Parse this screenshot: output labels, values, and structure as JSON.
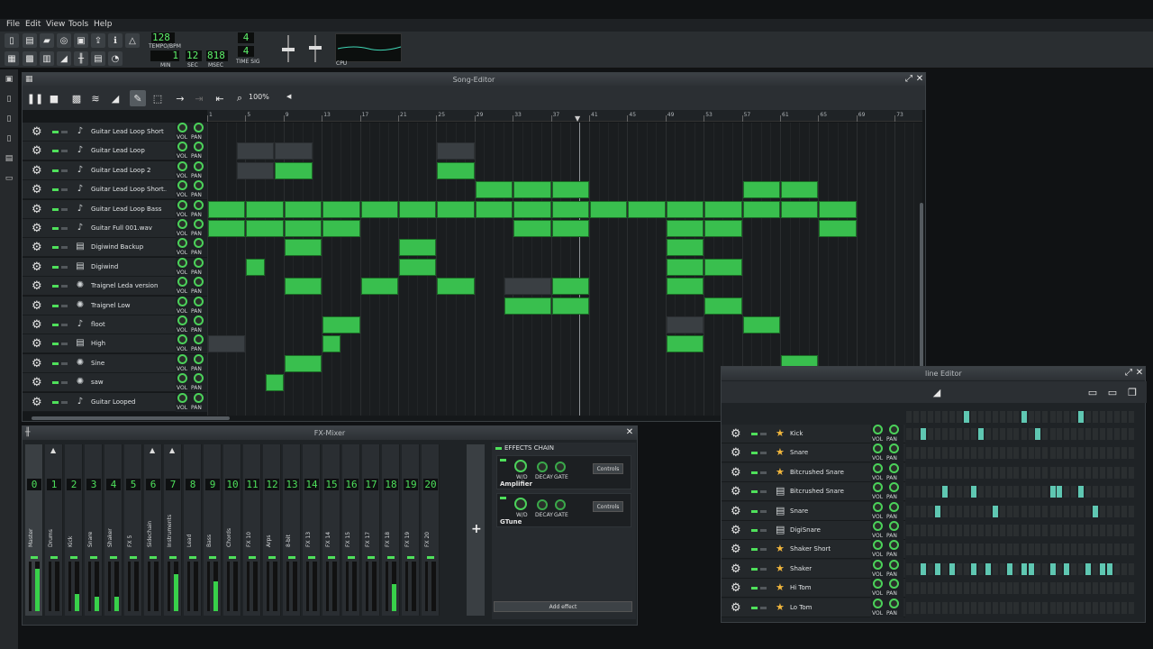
{
  "menu": [
    "File",
    "Edit",
    "View",
    "Tools",
    "Help"
  ],
  "lcd": {
    "tempo": "128",
    "tempo_label": "TEMPO/BPM",
    "min": "1",
    "min_label": "MIN",
    "sec": "12",
    "sec_label": "SEC",
    "msec": "818",
    "msec_label": "MSEC",
    "ts_num": "4",
    "ts_den": "4",
    "ts_label": "TIME SIG",
    "cpu_label": "CPU"
  },
  "song_editor": {
    "title": "Song-Editor",
    "zoom": "100%",
    "bars": [
      "1",
      "5",
      "9",
      "13",
      "17",
      "21",
      "25",
      "29",
      "33",
      "37",
      "41",
      "45",
      "49",
      "53",
      "57",
      "61",
      "65",
      "69",
      "73"
    ],
    "tracks": [
      {
        "name": "Guitar Lead Loop Short",
        "icon": "music-note-icon"
      },
      {
        "name": "Guitar Lead Loop",
        "icon": "music-note-icon"
      },
      {
        "name": "Guitar Lead Loop 2",
        "icon": "music-note-icon"
      },
      {
        "name": "Guitar Lead Loop Short...",
        "icon": "music-note-icon"
      },
      {
        "name": "Guitar Lead Loop Bass",
        "icon": "music-note-icon"
      },
      {
        "name": "Guitar Full 001.wav",
        "icon": "music-note-icon"
      },
      {
        "name": "Digiwind Backup",
        "icon": "sample-icon"
      },
      {
        "name": "Digiwind",
        "icon": "sample-icon"
      },
      {
        "name": "Traignel Leda version",
        "icon": "synth-icon"
      },
      {
        "name": "Traignel Low",
        "icon": "synth-icon"
      },
      {
        "name": "floot",
        "icon": "music-note-icon"
      },
      {
        "name": "High",
        "icon": "sample-icon"
      },
      {
        "name": "Sine",
        "icon": "synth-icon"
      },
      {
        "name": "saw",
        "icon": "synth-icon"
      },
      {
        "name": "Guitar Looped",
        "icon": "music-note-icon"
      }
    ],
    "vol_label": "VOL",
    "pan_label": "PAN"
  },
  "mixer": {
    "title": "FX-Mixer",
    "channels": [
      {
        "num": "0",
        "name": "Master",
        "level": 0.85
      },
      {
        "num": "1",
        "name": "Drums",
        "level": 0
      },
      {
        "num": "2",
        "name": "Kick",
        "level": 0.35
      },
      {
        "num": "3",
        "name": "Snare",
        "level": 0.3
      },
      {
        "num": "4",
        "name": "Shaker",
        "level": 0.3
      },
      {
        "num": "5",
        "name": "FX 5",
        "level": 0
      },
      {
        "num": "6",
        "name": "Sidechain",
        "level": 0
      },
      {
        "num": "7",
        "name": "Instruments",
        "level": 0.75
      },
      {
        "num": "8",
        "name": "Lead",
        "level": 0
      },
      {
        "num": "9",
        "name": "Bass",
        "level": 0.6
      },
      {
        "num": "10",
        "name": "Chords",
        "level": 0
      },
      {
        "num": "11",
        "name": "FX 10",
        "level": 0
      },
      {
        "num": "12",
        "name": "Arps",
        "level": 0
      },
      {
        "num": "13",
        "name": "8-bit",
        "level": 0
      },
      {
        "num": "14",
        "name": "FX 13",
        "level": 0
      },
      {
        "num": "15",
        "name": "FX 14",
        "level": 0
      },
      {
        "num": "16",
        "name": "FX 15",
        "level": 0
      },
      {
        "num": "17",
        "name": "FX 17",
        "level": 0
      },
      {
        "num": "18",
        "name": "FX 18",
        "level": 0.55
      },
      {
        "num": "19",
        "name": "FX 19",
        "level": 0
      },
      {
        "num": "20",
        "name": "FX 20",
        "level": 0
      }
    ],
    "effects_chain_label": "EFFECTS CHAIN",
    "effects": [
      {
        "name": "Amplifier",
        "wd": "W/D",
        "decay": "DECAY",
        "gate": "GATE",
        "controls": "Controls"
      },
      {
        "name": "GTune",
        "wd": "W/D",
        "decay": "DECAY",
        "gate": "GATE",
        "controls": "Controls"
      }
    ],
    "add_effect": "Add effect"
  },
  "beat_bassline": {
    "title": "line Editor",
    "tracks": [
      {
        "name": "Kick",
        "icon": "star-icon",
        "steps": [
          2,
          10,
          18
        ]
      },
      {
        "name": "Snare",
        "icon": "star-icon",
        "steps": []
      },
      {
        "name": "Bitcrushed Snare",
        "icon": "star-icon",
        "steps": []
      },
      {
        "name": "Bitcrushed Snare",
        "icon": "sample-icon",
        "steps": [
          5,
          9,
          20,
          21,
          24
        ]
      },
      {
        "name": "Snare",
        "icon": "sample-icon",
        "steps": [
          4,
          12,
          26
        ]
      },
      {
        "name": "DigiSnare",
        "icon": "sample-icon",
        "steps": []
      },
      {
        "name": "Shaker Short",
        "icon": "star-icon",
        "steps": []
      },
      {
        "name": "Shaker",
        "icon": "star-icon",
        "steps": [
          2,
          4,
          6,
          9,
          11,
          14,
          16,
          17,
          20,
          22,
          25,
          27,
          28
        ]
      },
      {
        "name": "Hi Tom",
        "icon": "star-icon",
        "steps": []
      },
      {
        "name": "Lo Tom",
        "icon": "star-icon",
        "steps": []
      }
    ]
  }
}
